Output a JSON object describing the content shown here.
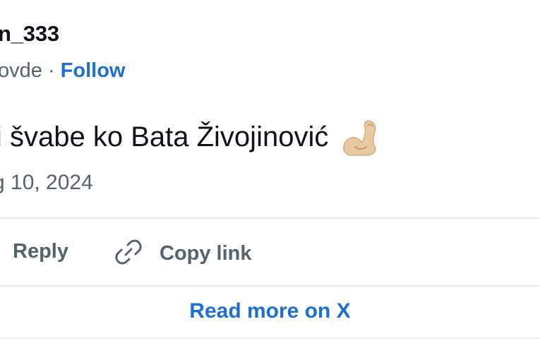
{
  "author": {
    "handle": "n_333"
  },
  "meta": {
    "location_fragment": "ovde",
    "separator": " · ",
    "follow_label": "Follow"
  },
  "tweet": {
    "text": "i švabe ko Bata Živojinović",
    "emoji_icon": "flexed-biceps-icon"
  },
  "date": "g 10, 2024",
  "actions": {
    "reply_label": "Reply",
    "copy_link_label": "Copy link",
    "link_icon": "link-icon"
  },
  "footer": {
    "read_more_label": "Read more on X"
  },
  "colors": {
    "accent": "#1d6fd1",
    "muted": "#536471",
    "text": "#0f1419",
    "divider": "#e6ecf0"
  }
}
